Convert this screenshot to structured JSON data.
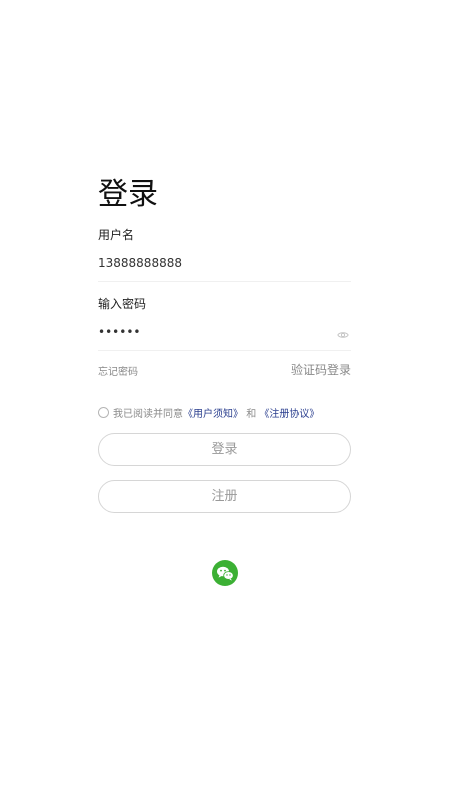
{
  "login": {
    "title": "登录",
    "username_label": "用户名",
    "username_value": "13888888888",
    "password_label": "输入密码",
    "password_value": "••••••",
    "forgot_password": "忘记密码",
    "code_login": "验证码登录",
    "agreement": {
      "prefix": "我已阅读并同意",
      "user_notice": "《用户须知》",
      "and": "和",
      "register_agreement": "《注册协议》",
      "checked": false
    },
    "login_button": "登录",
    "register_button": "注册",
    "social_icon": "wechat-icon"
  },
  "colors": {
    "title": "#111111",
    "link_blue": "#2b3f8f",
    "muted": "#888888",
    "button_border": "#d6d6d6",
    "button_text": "#999999",
    "wechat_green": "#3cb034"
  }
}
